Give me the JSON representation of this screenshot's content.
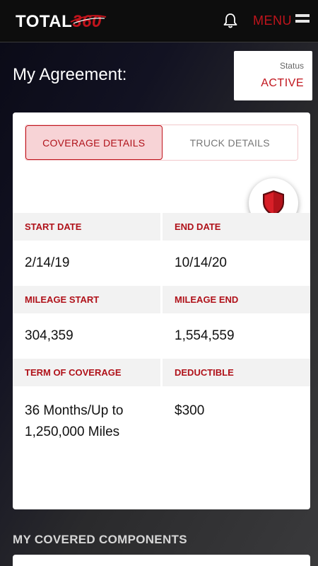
{
  "header": {
    "logo_text": "TOTAL",
    "logo_number": "360",
    "menu_label": "MENU"
  },
  "page": {
    "title": "My Agreement:"
  },
  "status": {
    "label": "Status",
    "value": "ACTIVE"
  },
  "tabs": [
    {
      "label": "COVERAGE DETAILS",
      "active": true
    },
    {
      "label": "TRUCK DETAILS",
      "active": false
    }
  ],
  "details": {
    "start_date_label": "START DATE",
    "start_date": "2/14/19",
    "end_date_label": "END DATE",
    "end_date": "10/14/20",
    "mileage_start_label": "MILEAGE START",
    "mileage_start": "304,359",
    "mileage_end_label": "MILEAGE END",
    "mileage_end": "1,554,559",
    "term_label": "TERM OF COVERAGE",
    "term_line1": "36 Months/Up to",
    "term_line2": "1,250,000 Miles",
    "deductible_label": "DEDUCTIBLE",
    "deductible": "$300"
  },
  "components": {
    "section_title": "MY COVERED COMPONENTS"
  },
  "icons": {
    "bell": "bell-icon",
    "hamburger": "hamburger-menu-icon",
    "shield": "shield-icon"
  },
  "colors": {
    "accent": "#c0141c",
    "tab_active_bg": "#f7d3d6",
    "header_bg": "#0d0d0d"
  }
}
